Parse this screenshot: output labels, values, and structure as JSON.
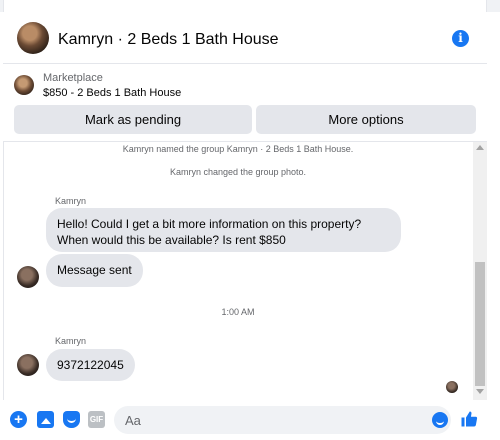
{
  "header": {
    "title": "Kamryn · 2 Beds 1 Bath House",
    "info_icon": "info-icon"
  },
  "listing": {
    "label": "Marketplace",
    "price_title": "$850 - 2 Beds 1 Bath House",
    "buttons": {
      "pending": "Mark as pending",
      "more": "More options"
    }
  },
  "chat": {
    "system_messages": [
      "Kamryn named the group Kamryn · 2 Beds 1 Bath House.",
      "Kamryn changed the group photo."
    ],
    "messages": [
      {
        "sender": "Kamryn",
        "lines": [
          "Hello! Could I get a bit more information on this property?",
          "When would this be available? Is rent $850"
        ]
      },
      {
        "text": "Message sent"
      }
    ],
    "timestamp": "1:00 AM",
    "messages_after": [
      {
        "sender": "Kamryn",
        "text": "9372122045"
      }
    ]
  },
  "composer": {
    "placeholder": "Aa",
    "icons": [
      "plus-icon",
      "photo-icon",
      "sticker-icon",
      "gif-icon",
      "emoji-icon",
      "like-icon"
    ],
    "gif_label": "GIF"
  },
  "colors": {
    "accent": "#1877f2",
    "bubble": "#e4e6eb",
    "muted_text": "#65676b"
  }
}
